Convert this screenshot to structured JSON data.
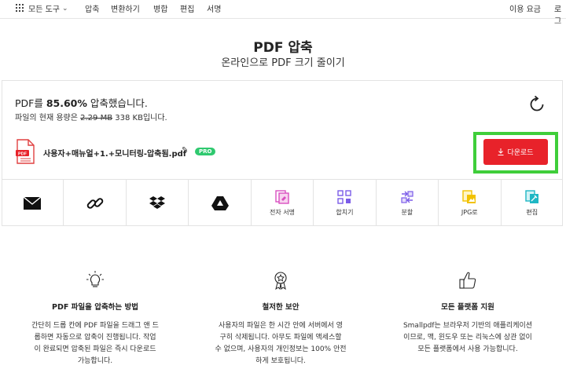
{
  "nav": {
    "all_tools": "모든 도구",
    "items": [
      "압축",
      "변환하기",
      "병합",
      "편집",
      "서명"
    ],
    "pricing": "이용 요금",
    "login": "로그"
  },
  "header": {
    "title": "PDF 압축",
    "subtitle": "온라인으로 PDF 크기 줄이기"
  },
  "result": {
    "status_prefix": "PDF를 ",
    "status_percent": "85.60%",
    "status_suffix": " 압축했습니다.",
    "size_prefix": "파일의 현재 용량은 ",
    "old_size": "2.29 MB",
    "new_size": " 338 KB입니다.",
    "file_name": "사용자+매뉴얼+1.+모니터링-압축됨.pdf",
    "pro_badge": "PRO",
    "download_label": "다운로드"
  },
  "tools": [
    {
      "icon": "mail-icon",
      "label": ""
    },
    {
      "icon": "link-icon",
      "label": ""
    },
    {
      "icon": "dropbox-icon",
      "label": ""
    },
    {
      "icon": "google-drive-icon",
      "label": ""
    },
    {
      "icon": "esign-icon",
      "label": "전자 서명"
    },
    {
      "icon": "merge-icon",
      "label": "합치기"
    },
    {
      "icon": "split-icon",
      "label": "분할"
    },
    {
      "icon": "jpg-icon",
      "label": "JPG로"
    },
    {
      "icon": "edit-icon",
      "label": "편집"
    }
  ],
  "features": [
    {
      "icon": "lightbulb-icon",
      "title": "PDF 파일을 압축하는 방법",
      "lines": [
        "간단히 드롭 칸에 PDF 파일을 드래그 앤 드",
        "롭하면 자동으로 압축이 진행됩니다. 작업",
        "이 완료되면 압축된 파일은 즉시 다운로드",
        "가능합니다."
      ]
    },
    {
      "icon": "medal-icon",
      "title": "철저한 보안",
      "lines": [
        "사용자의 파일은 한 시간 안에 서버에서 영",
        "구히 삭제됩니다. 아무도 파일에 액세스할",
        "수 없으며, 사용자의 개인정보는 100% 안전",
        "하게 보호됩니다."
      ]
    },
    {
      "icon": "thumbs-up-icon",
      "title": "모든 플랫폼 지원",
      "lines": [
        "Smallpdf는 브라우저 기반의 애플리케이션",
        "이므로, 맥, 윈도우 또는 리눅스에 상관 없이",
        "모든 플랫폼에서 사용 가능합니다."
      ]
    }
  ],
  "colors": {
    "download_red": "#e8222a",
    "highlight_green": "#3fce3a",
    "pro_green": "#2fc96f",
    "tool_pink": "#d94fc0",
    "tool_purple": "#7b5ce8",
    "tool_yellow": "#f2c200",
    "tool_teal": "#1fb7c4"
  }
}
